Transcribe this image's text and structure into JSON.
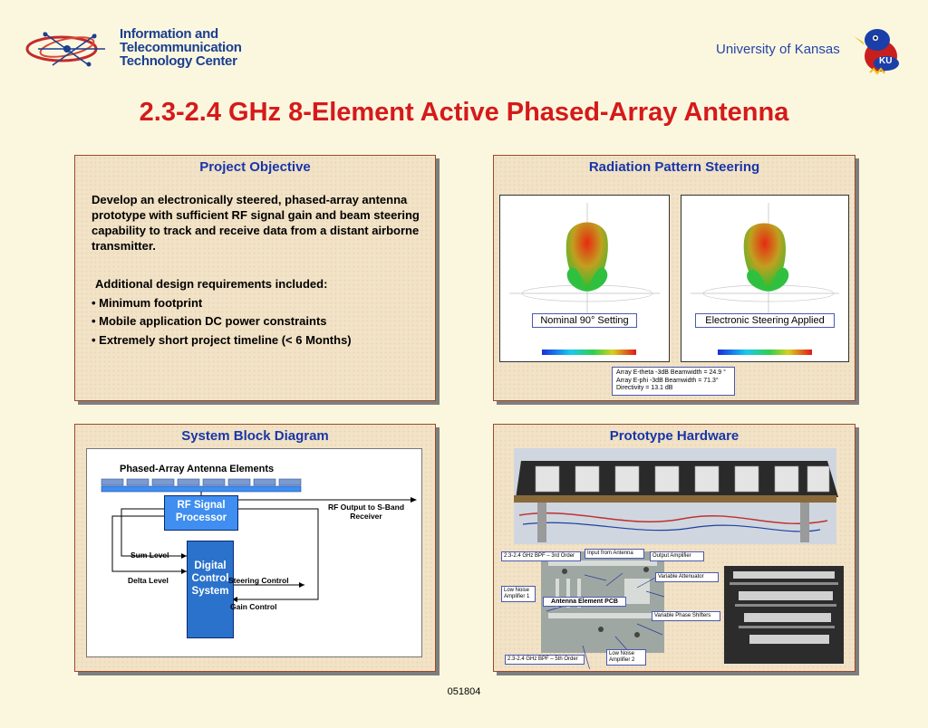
{
  "header": {
    "logo_lines": [
      "Information and",
      "Telecommunication",
      "Technology Center"
    ],
    "university": "University of Kansas",
    "mascot_icon": "jayhawk-icon",
    "title": "2.3-2.4 GHz 8-Element Active Phased-Array Antenna"
  },
  "objective": {
    "title": "Project Objective",
    "body": "Develop an electronically steered, phased-array antenna prototype with sufficient RF signal gain and beam steering capability to track and receive data from a distant airborne transmitter.",
    "req_intro": "Additional design requirements included:",
    "bullets": [
      "• Minimum footprint",
      "• Mobile application DC power constraints",
      "• Extremely short project timeline (< 6 Months)"
    ]
  },
  "radiation": {
    "title": "Radiation Pattern Steering",
    "left_caption": "Nominal 90° Setting",
    "right_caption": "Electronic Steering Applied",
    "info_lines": [
      "Array E-theta -3dB Beamwidth = 24.9 °",
      "Array E-phi    -3dB Beamwidth = 71.3°",
      "Directivity = 13.1 dB"
    ]
  },
  "block_diagram": {
    "title": "System Block Diagram",
    "elements_label": "Phased-Array Antenna Elements",
    "rf_block": [
      "RF Signal",
      "Processor"
    ],
    "dcs_block": [
      "Digital",
      "Control",
      "System"
    ],
    "rf_output": [
      "RF Output to S-Band",
      "Receiver"
    ],
    "sum_level": "Sum Level",
    "delta_level": "Delta Level",
    "steering_control": "Steering Control",
    "gain_control": "Gain Control"
  },
  "hardware": {
    "title": "Prototype Hardware",
    "labels": {
      "bpf3": "2.3-2.4 GHz BPF – 3rd Order",
      "input": "Input from Antenna",
      "output_amp": "Output Amplifier",
      "var_att": "Variable Attenuator",
      "lna1": "Low Noise Amplifier 1",
      "pcb": "Antenna Element PCB",
      "phase": "Variable Phase Shifters",
      "lna2": "Low Noise Amplifier 2",
      "bpf5": "2.3-2.4 GHz BPF – 5th Order"
    }
  },
  "footer": "051804",
  "colors": {
    "title_red": "#d51a1a",
    "heading_blue": "#1836a8",
    "panel_bg": "#f2e2c6",
    "rf_block": "#3f8ef0",
    "dcs_block": "#2a72cc"
  }
}
